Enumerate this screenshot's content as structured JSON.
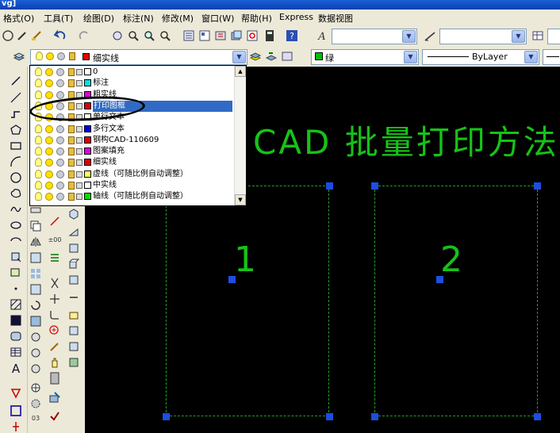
{
  "window": {
    "title": "vg]"
  },
  "menu": {
    "items": [
      "格式(O)",
      "工具(T)",
      "绘图(D)",
      "标注(N)",
      "修改(M)",
      "窗口(W)",
      "帮助(H)",
      "Express",
      "数据视图"
    ]
  },
  "toolbar": {
    "layer_combo_value": "细实线",
    "color_combo_value": "绿",
    "color_swatch": "#00c000",
    "linetype_combo_value": "ByLayer"
  },
  "layers": [
    {
      "name": "0",
      "color": "#ffffff"
    },
    {
      "name": "标注",
      "color": "#00e0e0"
    },
    {
      "name": "粗实线",
      "color": "#e000e0"
    },
    {
      "name": "打印图框",
      "color": "#e00000",
      "selected": true
    },
    {
      "name": "单行文本",
      "color": "#ffffff"
    },
    {
      "name": "多行文本",
      "color": "#0000e0"
    },
    {
      "name": "钢构CAD-110609",
      "color": "#e00000"
    },
    {
      "name": "图案填充",
      "color": "#e000e0"
    },
    {
      "name": "细实线",
      "color": "#e00000"
    },
    {
      "name": "虚线（可随比例自动调整）",
      "color": "#ffff60"
    },
    {
      "name": "中实线",
      "color": "#ffffff"
    },
    {
      "name": "轴线（可随比例自动调整）",
      "color": "#00e000"
    }
  ],
  "drawing": {
    "title_text": "CAD 批量打印方法步骤",
    "viewport_1_label": "1",
    "viewport_2_label": "2",
    "text_color": "#17c217",
    "grip_color": "#1e4de0"
  }
}
